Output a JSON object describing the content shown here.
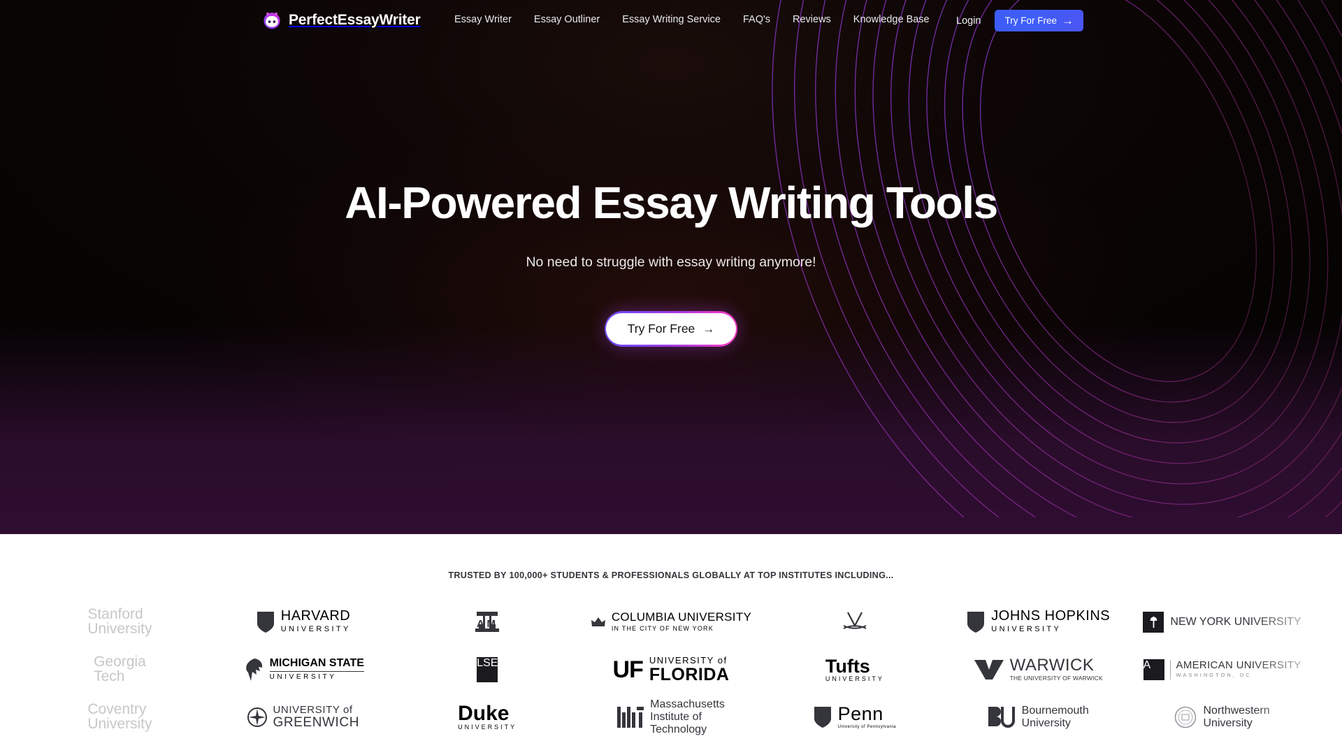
{
  "brand": {
    "name": "PerfectEssayWriter",
    "logo_icon": "robot-head-icon",
    "logo_gradient_from": "#c233e8",
    "logo_gradient_to": "#7b3ff0"
  },
  "header": {
    "nav_items": [
      {
        "label": "Essay Writer"
      },
      {
        "label": "Essay Outliner"
      },
      {
        "label": "Essay Writing Service"
      },
      {
        "label": "FAQ's"
      },
      {
        "label": "Reviews"
      },
      {
        "label": "Knowledge Base"
      }
    ],
    "login_label": "Login",
    "cta_label": "Try For Free",
    "cta_arrow": "→",
    "cta_color": "#3f5ef8"
  },
  "hero": {
    "title": "AI-Powered Essay Writing Tools",
    "subtitle": "No need to struggle with essay writing anymore!",
    "cta_label": "Try For Free",
    "cta_arrow": "→",
    "background_color": "#0a0404",
    "accent_gradient_from": "#6f4bf0",
    "accent_gradient_to": "#f03cbe"
  },
  "trusted": {
    "label": "TRUSTED BY 100,000+ STUDENTS & PROFESSIONALS GLOBALLY AT TOP INSTITUTES INCLUDING...",
    "logos": [
      {
        "id": "stanford",
        "name": "Stanford University",
        "line1": "Stanford",
        "line2": "University",
        "style": "serif-two-line",
        "faded": true
      },
      {
        "id": "harvard",
        "name": "Harvard University",
        "line1": "HARVARD",
        "line2": "UNIVERSITY",
        "style": "shield-serif",
        "faded": false
      },
      {
        "id": "texas-am",
        "name": "Texas A&M University",
        "line1": "ATM",
        "line2": "",
        "style": "mark-only",
        "faded": false
      },
      {
        "id": "columbia",
        "name": "Columbia University",
        "line1": "COLUMBIA UNIVERSITY",
        "line2": "IN THE CITY OF NEW YORK",
        "style": "crown-serif",
        "faded": false
      },
      {
        "id": "virginia",
        "name": "University of Virginia",
        "line1": "",
        "line2": "",
        "style": "mark-only",
        "faded": false
      },
      {
        "id": "johns-hopkins",
        "name": "Johns Hopkins University",
        "line1": "JOHNS HOPKINS",
        "line2": "UNIVERSITY",
        "style": "shield-serif",
        "faded": false
      },
      {
        "id": "nyu",
        "name": "New York University",
        "line1": "NEW YORK UNIVERSITY",
        "line2": "",
        "style": "box-mark",
        "faded": false
      },
      {
        "id": "georgia-tech",
        "name": "Georgia Tech",
        "line1": "Georgia",
        "line2": "Tech",
        "style": "serif-two-line",
        "faded": true
      },
      {
        "id": "michigan-state",
        "name": "Michigan State University",
        "line1": "MICHIGAN STATE",
        "line2": "UNIVERSITY",
        "style": "spartan-serif",
        "faded": false
      },
      {
        "id": "lse",
        "name": "London School of Economics",
        "line1": "LSE",
        "line2": "",
        "style": "box-mark",
        "faded": false
      },
      {
        "id": "florida",
        "name": "University of Florida",
        "line1": "UNIVERSITY of",
        "line2": "FLORIDA",
        "style": "uf-serif",
        "faded": false
      },
      {
        "id": "tufts",
        "name": "Tufts University",
        "line1": "Tufts",
        "line2": "UNIVERSITY",
        "style": "serif-two-line",
        "faded": false
      },
      {
        "id": "warwick",
        "name": "The University of Warwick",
        "line1": "WARWICK",
        "line2": "THE UNIVERSITY OF WARWICK",
        "style": "chevron-mark",
        "faded": false
      },
      {
        "id": "american",
        "name": "American University Washington DC",
        "line1": "AMERICAN UNIVERSITY",
        "line2": "WASHINGTON, DC",
        "style": "box-serif",
        "faded": false
      },
      {
        "id": "coventry",
        "name": "Coventry University",
        "line1": "Coventry",
        "line2": "University",
        "style": "serif-two-line",
        "faded": true
      },
      {
        "id": "greenwich",
        "name": "University of Greenwich",
        "line1": "UNIVERSITY of",
        "line2": "GREENWICH",
        "style": "compass-serif",
        "faded": false
      },
      {
        "id": "duke",
        "name": "Duke University",
        "line1": "Duke",
        "line2": "UNIVERSITY",
        "style": "serif-two-line",
        "faded": false
      },
      {
        "id": "mit",
        "name": "Massachusetts Institute of Technology",
        "line1": "Massachusetts",
        "line2": "Institute of Technology",
        "style": "mit-bars",
        "faded": false
      },
      {
        "id": "penn",
        "name": "University of Pennsylvania",
        "line1": "Penn",
        "line2": "University of Pennsylvania",
        "style": "shield-serif",
        "faded": false
      },
      {
        "id": "bournemouth",
        "name": "Bournemouth University",
        "line1": "Bournemouth",
        "line2": "University",
        "style": "bu-mark",
        "faded": false
      },
      {
        "id": "northwestern",
        "name": "Northwestern University",
        "line1": "Northwestern",
        "line2": "University",
        "style": "seal-serif",
        "faded": false
      }
    ]
  }
}
